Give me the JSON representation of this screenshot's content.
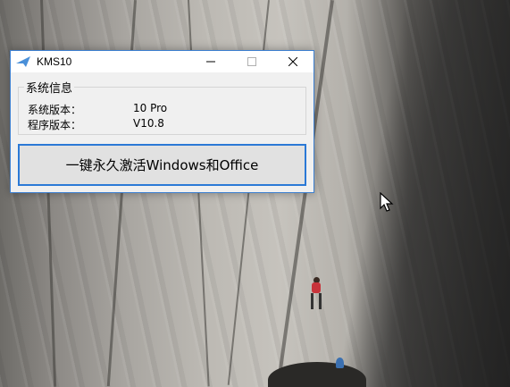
{
  "window": {
    "title": "KMS10",
    "controls": {
      "minimize_icon": "minimize-icon",
      "maximize_icon": "maximize-icon",
      "close_icon": "close-icon"
    }
  },
  "system_info": {
    "legend": "系统信息",
    "rows": [
      {
        "label": "系统版本：",
        "value": "10 Pro"
      },
      {
        "label": "程序版本：",
        "value": "V10.8"
      }
    ]
  },
  "activate_button": {
    "label": "一键永久激活Windows和Office"
  },
  "colors": {
    "accent": "#2b79d6",
    "window_bg": "#f0f0f0",
    "titlebar_bg": "#ffffff"
  }
}
